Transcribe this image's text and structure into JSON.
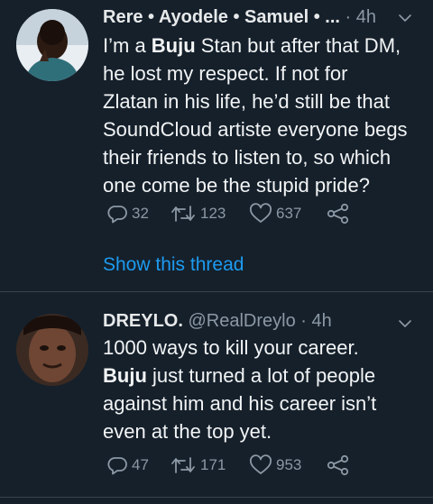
{
  "tweets": [
    {
      "name": "Rere • Ayodele • Samuel • ...",
      "handle": "",
      "time": "· 4h",
      "text_parts": [
        "I’m a ",
        "Buju",
        " Stan but after that DM, he lost my respect. If not for Zlatan in his life, he’d still be that SoundCloud artiste everyone begs their friends to listen to, so which one come be the stupid pride?"
      ],
      "replies": "32",
      "retweets": "123",
      "likes": "637",
      "show_thread": "Show this thread"
    },
    {
      "name": "DREYLO.",
      "handle": "@RealDreylo",
      "time": "· 4h",
      "text_parts": [
        "1000 ways to kill your career. ",
        "Buju",
        " just turned a lot of people against him and his career isn’t even at the top yet."
      ],
      "replies": "47",
      "retweets": "171",
      "likes": "953"
    }
  ],
  "icons": {
    "reply": "reply-icon",
    "retweet": "retweet-icon",
    "like": "heart-icon",
    "share": "share-icon",
    "caret": "chevron-down-icon"
  },
  "colors": {
    "background": "#15202b",
    "link": "#1d9bf0",
    "muted": "#8b98a5",
    "separator": "#38444d"
  }
}
